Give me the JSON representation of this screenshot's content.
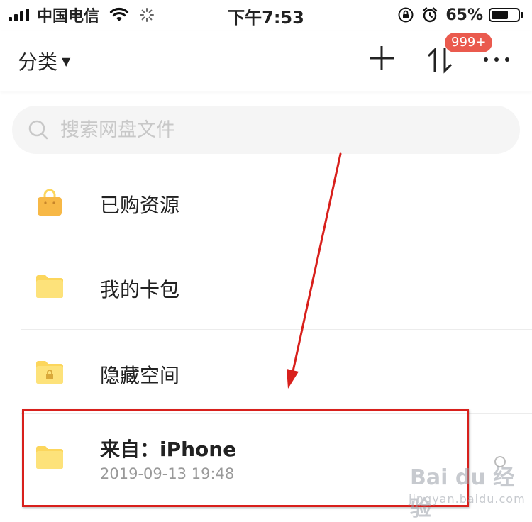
{
  "status_bar": {
    "carrier": "中国电信",
    "time": "下午7:53",
    "battery_percent": "65%",
    "battery_level": 0.65,
    "icons": [
      "signal-icon",
      "wifi-icon",
      "loading-icon",
      "rotation-lock-icon",
      "alarm-icon",
      "battery-icon"
    ]
  },
  "header": {
    "category_label": "分类",
    "badge": "999+",
    "icons": [
      "add-icon",
      "sort-icon",
      "more-icon"
    ]
  },
  "search": {
    "placeholder": "搜索网盘文件"
  },
  "files": [
    {
      "name": "已购资源",
      "icon": "shopping-bag-icon"
    },
    {
      "name": "我的卡包",
      "icon": "folder-icon"
    },
    {
      "name": "隐藏空间",
      "icon": "locked-folder-icon"
    },
    {
      "name": "来自：iPhone",
      "date": "2019-09-13 19:48",
      "icon": "folder-icon"
    }
  ],
  "watermark": {
    "main": "Bai du 经验",
    "sub": "jingyan.baidu.com"
  },
  "colors": {
    "folder": "#fcd65c",
    "badge": "#ea5a4e",
    "annotation": "#d8201c"
  }
}
